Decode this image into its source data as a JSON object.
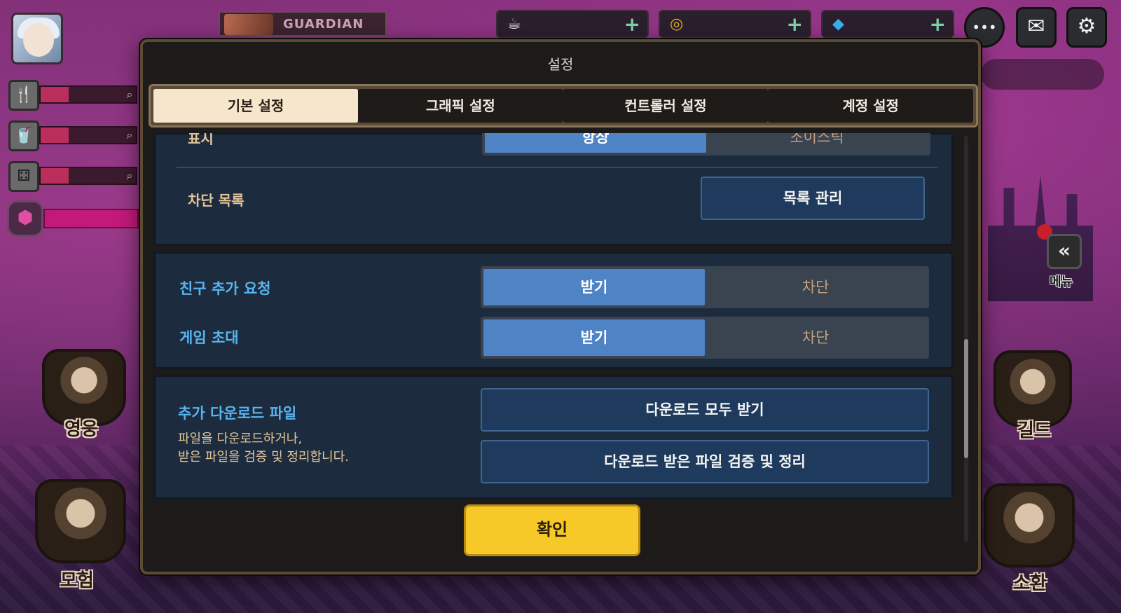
{
  "hud": {
    "guardian_banner": "GUARDIAN",
    "currencies": [
      {
        "icon": "coffee-icon",
        "glyph": "☕",
        "plus": "+"
      },
      {
        "icon": "gold-coin-icon",
        "glyph": "◎",
        "plus": "+"
      },
      {
        "icon": "gem-icon",
        "glyph": "◆",
        "plus": "+"
      }
    ],
    "top_icons": {
      "chat": "•••",
      "mail": "✉",
      "settings": "⚙"
    },
    "left_slots": [
      "🍴",
      "🥤",
      "⚃"
    ],
    "gem_slot": "⬢",
    "menu": {
      "icon": "«",
      "label": "메뉴"
    },
    "side": {
      "hero": "영웅",
      "adventure": "모험",
      "guild": "길드",
      "summon": "소환"
    }
  },
  "settings": {
    "title": "설정",
    "tabs": [
      {
        "label": "기본 설정",
        "active": true
      },
      {
        "label": "그래픽 설정",
        "active": false
      },
      {
        "label": "컨트롤러 설정",
        "active": false
      },
      {
        "label": "계정 설정",
        "active": false
      }
    ],
    "display_row": {
      "label": "표시",
      "options": [
        "항상",
        "조이스틱"
      ]
    },
    "block_list": {
      "label": "차단 목록",
      "button": "목록 관리"
    },
    "friend_request": {
      "label": "친구 추가 요청",
      "options": [
        "받기",
        "차단"
      ],
      "selected": 0
    },
    "game_invite": {
      "label": "게임 초대",
      "options": [
        "받기",
        "차단"
      ],
      "selected": 0
    },
    "downloads": {
      "label": "추가 다운로드 파일",
      "desc_line1": "파일을 다운로드하거나,",
      "desc_line2": "받은 파일을 검증 및 정리합니다.",
      "btn_all": "다운로드 모두 받기",
      "btn_verify": "다운로드 받은 파일 검증 및 정리"
    },
    "confirm": "확인"
  }
}
